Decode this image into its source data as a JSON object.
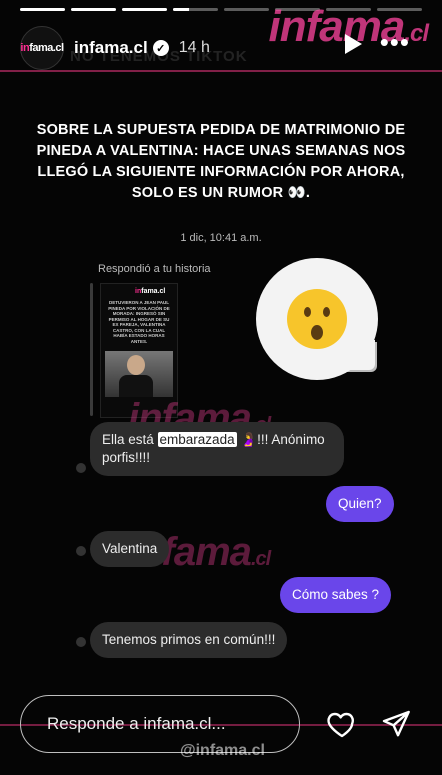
{
  "story": {
    "progress": [
      1,
      1,
      1,
      0.35,
      0,
      0,
      0,
      0
    ],
    "account": "infama.cl",
    "verified_badge": "✓",
    "time": "14 h",
    "avatar_text": "infama.cl",
    "icons": {
      "play": "play-icon",
      "more": "more-icon"
    }
  },
  "watermark": {
    "brand": "infama",
    "suffix": ".cl",
    "ghost": "NO TENEMOS TIKTOK",
    "handle": "@infama.cl"
  },
  "headline": "SOBRE LA SUPUESTA PEDIDA DE MATRIMONIO DE PINEDA A VALENTINA: HACE UNAS SEMANAS NOS LLEGÓ LA SIGUIENTE INFORMACIÓN POR AHORA, SOLO ES UN RUMOR 👀.",
  "chat": {
    "date": "1 dic, 10:41 a.m.",
    "replied_label": "Respondió a tu historia",
    "card": {
      "logo": "infama.cl",
      "text": "DETUVIERON A JEAN PAUL PINEDA POR VIOLACIÓN DE MORADA: INGRESÓ SIN PERMISO AL HOGAR DE SU EX PAREJA, VALENTINA CASTRO, CON LA CUAL HABÍA ESTADO HORAS ANTES."
    },
    "reaction_emoji": "😮",
    "messages": [
      {
        "side": "left",
        "pre": "Ella está ",
        "highlight": "embarazada",
        "post": " 🤰!!! Anónimo porfis!!!!"
      },
      {
        "side": "right",
        "text": "Quien?"
      },
      {
        "side": "left",
        "text": "Valentina"
      },
      {
        "side": "right",
        "text": "Cómo sabes ?"
      },
      {
        "side": "left",
        "text": "Tenemos primos en común!!!"
      }
    ]
  },
  "reply": {
    "placeholder": "Responde a infama.cl...",
    "icons": {
      "heart": "heart-icon",
      "send": "send-icon"
    }
  }
}
